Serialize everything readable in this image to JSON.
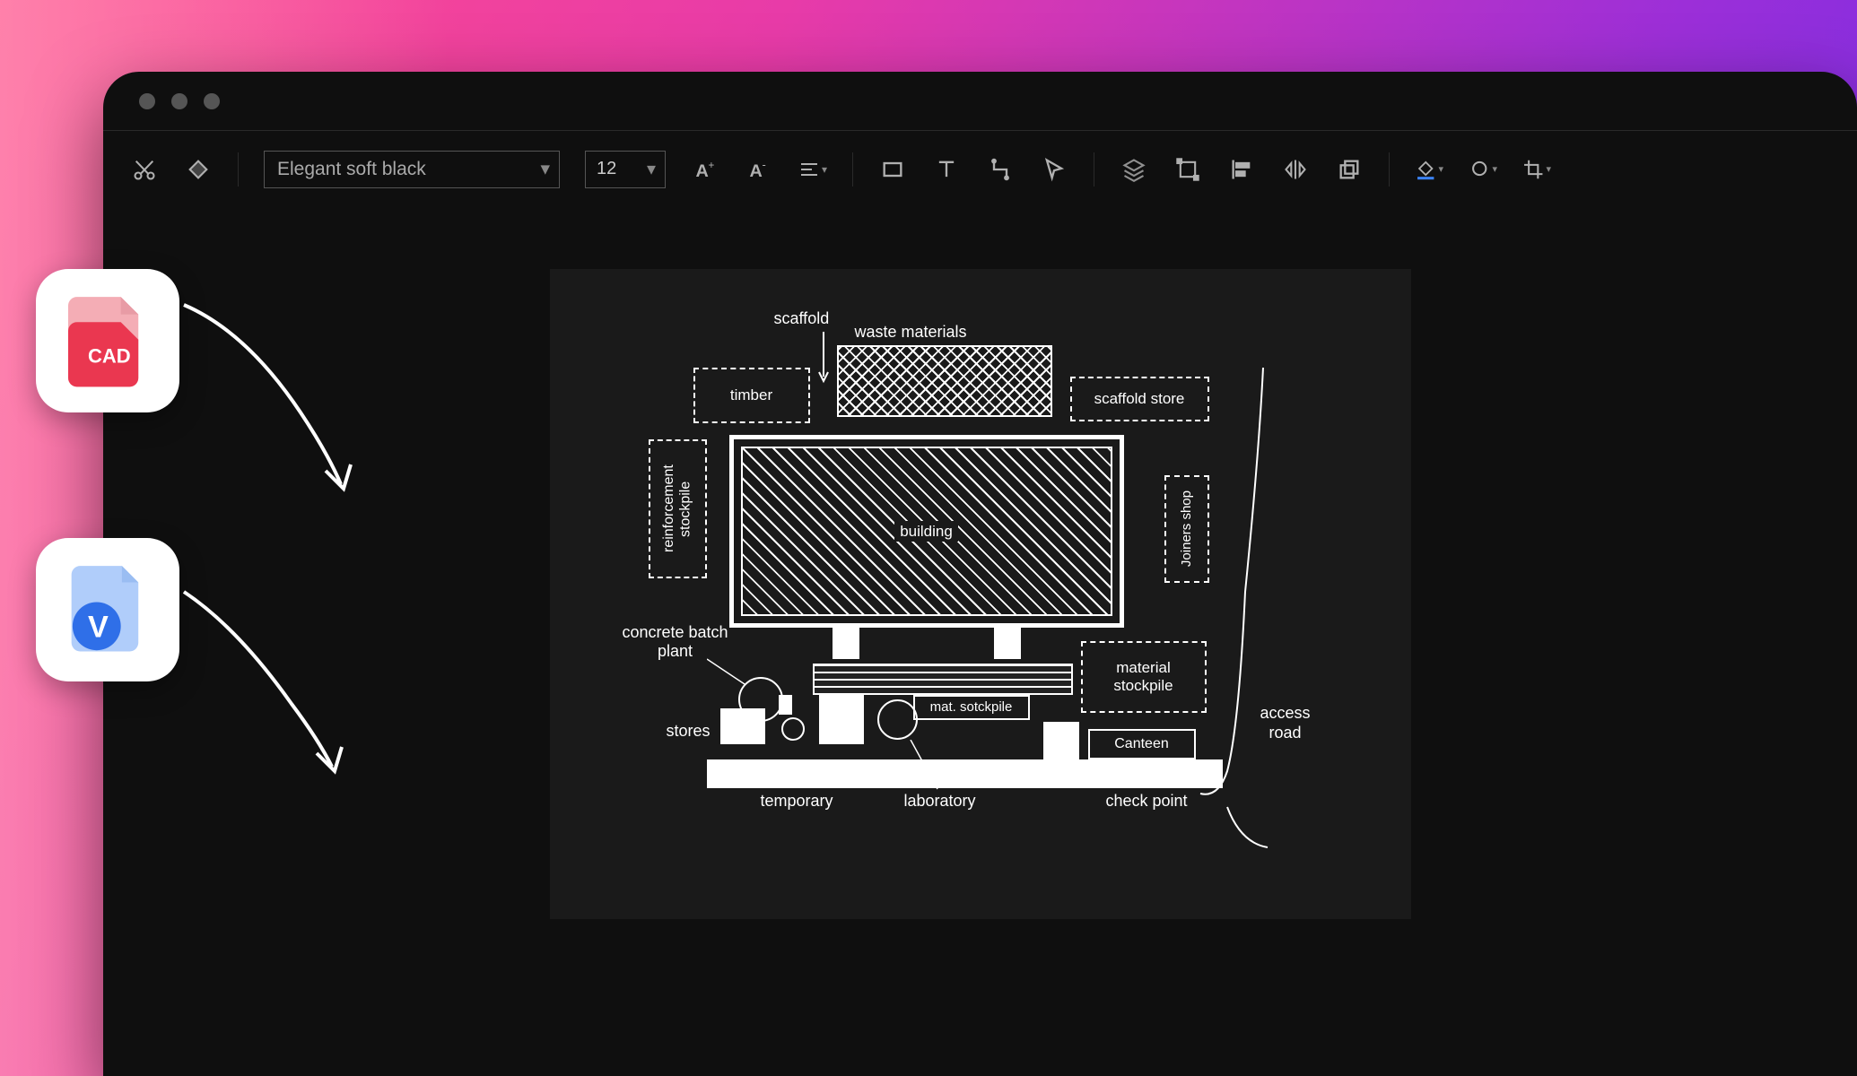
{
  "toolbar": {
    "font_name": "Elegant soft black",
    "font_size": "12"
  },
  "file_cards": {
    "cad_label": "CAD",
    "v_label": "V"
  },
  "diagram": {
    "scaffold": "scaffold",
    "waste_materials": "waste materials",
    "timber": "timber",
    "scaffold_store": "scaffold store",
    "reinforcement_stockpile": "reinforcement stockpile",
    "building": "building",
    "joiners_shop": "Joiners shop",
    "concrete_batch_plant": "concrete batch plant",
    "material_stockpile": "material stockpile",
    "mat_stockpile": "mat. sotckpile",
    "stores": "stores",
    "temporary": "temporary",
    "laboratory": "laboratory",
    "canteen": "Canteen",
    "check_point": "check point",
    "access_road": "access road"
  }
}
